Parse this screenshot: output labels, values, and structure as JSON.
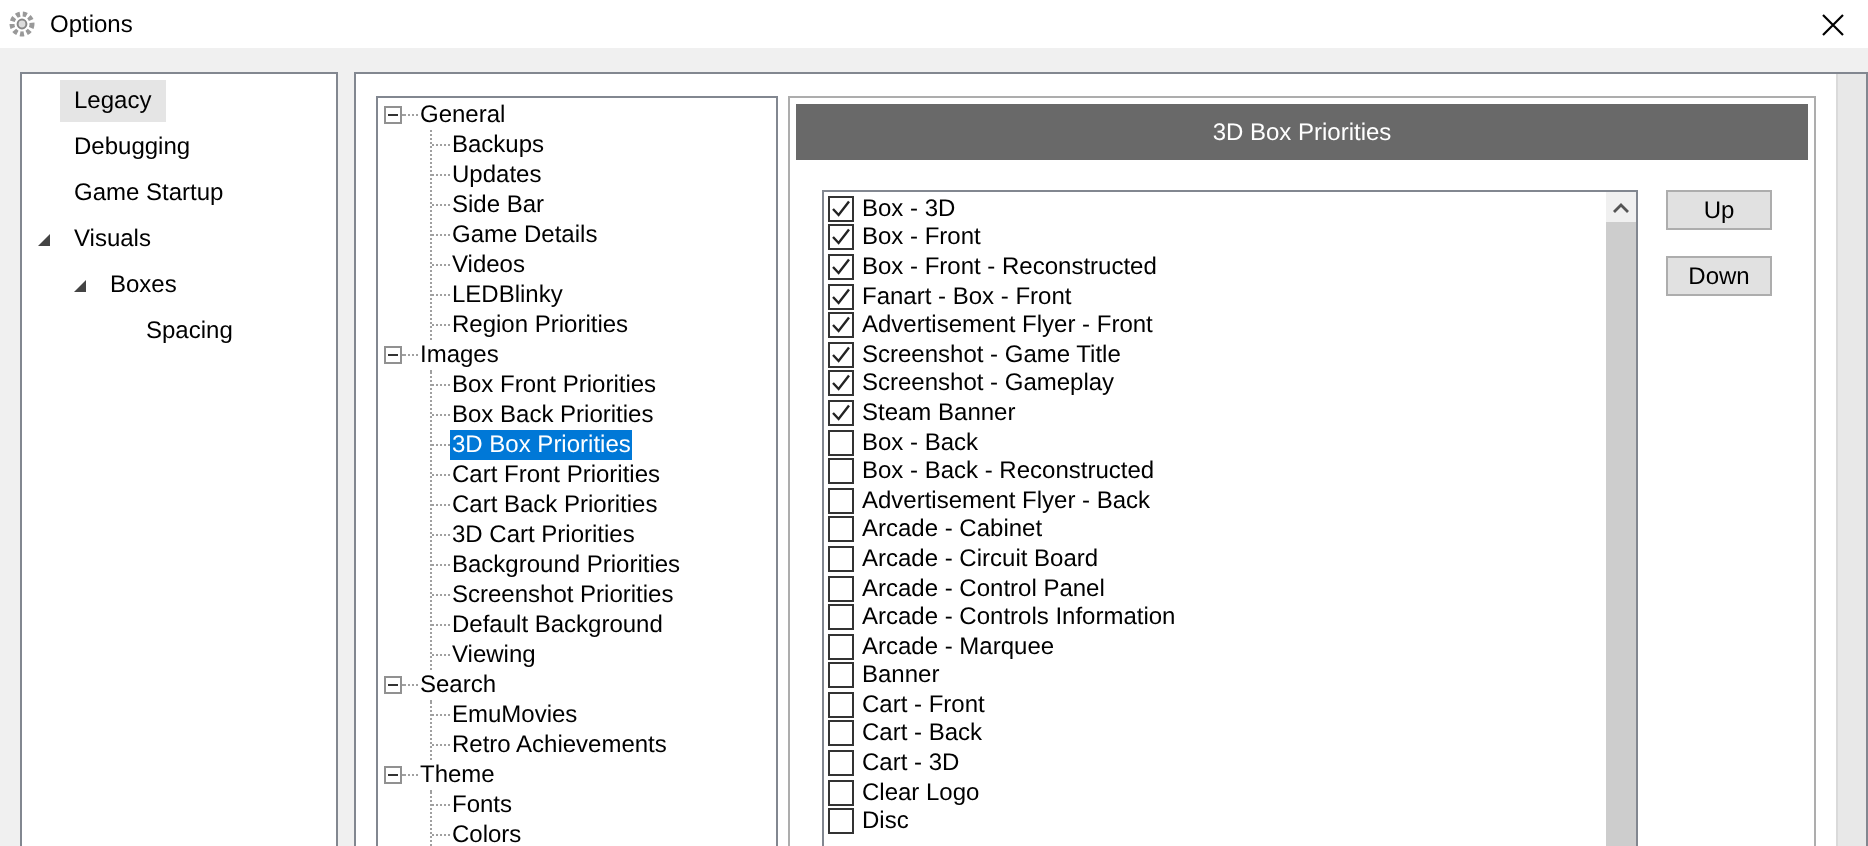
{
  "window": {
    "title": "Options"
  },
  "sidebar": {
    "items": [
      {
        "label": "Legacy",
        "selected": true
      },
      {
        "label": "Debugging",
        "selected": false
      },
      {
        "label": "Game Startup",
        "selected": false
      },
      {
        "label": "Visuals",
        "selected": false,
        "expanded": true,
        "children": [
          {
            "label": "Boxes",
            "selected": false,
            "expanded": true,
            "children": [
              {
                "label": "Spacing",
                "selected": false
              }
            ]
          }
        ]
      }
    ]
  },
  "tree": {
    "items": [
      {
        "label": "General",
        "selected": false,
        "expanded": true,
        "children": [
          {
            "label": "Backups",
            "selected": false
          },
          {
            "label": "Updates",
            "selected": false
          },
          {
            "label": "Side Bar",
            "selected": false
          },
          {
            "label": "Game Details",
            "selected": false
          },
          {
            "label": "Videos",
            "selected": false
          },
          {
            "label": "LEDBlinky",
            "selected": false
          },
          {
            "label": "Region Priorities",
            "selected": false
          }
        ]
      },
      {
        "label": "Images",
        "selected": false,
        "expanded": true,
        "children": [
          {
            "label": "Box Front Priorities",
            "selected": false
          },
          {
            "label": "Box Back Priorities",
            "selected": false
          },
          {
            "label": "3D Box Priorities",
            "selected": true
          },
          {
            "label": "Cart Front Priorities",
            "selected": false
          },
          {
            "label": "Cart Back Priorities",
            "selected": false
          },
          {
            "label": "3D Cart Priorities",
            "selected": false
          },
          {
            "label": "Background Priorities",
            "selected": false
          },
          {
            "label": "Screenshot Priorities",
            "selected": false
          },
          {
            "label": "Default Background",
            "selected": false
          },
          {
            "label": "Viewing",
            "selected": false
          }
        ]
      },
      {
        "label": "Search",
        "selected": false,
        "expanded": true,
        "children": [
          {
            "label": "EmuMovies",
            "selected": false
          },
          {
            "label": "Retro Achievements",
            "selected": false
          }
        ]
      },
      {
        "label": "Theme",
        "selected": false,
        "expanded": true,
        "children": [
          {
            "label": "Fonts",
            "selected": false
          },
          {
            "label": "Colors",
            "selected": false
          }
        ]
      }
    ]
  },
  "panel": {
    "title": "3D Box Priorities",
    "items": [
      {
        "label": "Box - 3D",
        "checked": true
      },
      {
        "label": "Box - Front",
        "checked": true
      },
      {
        "label": "Box - Front - Reconstructed",
        "checked": true
      },
      {
        "label": "Fanart - Box - Front",
        "checked": true
      },
      {
        "label": "Advertisement Flyer - Front",
        "checked": true
      },
      {
        "label": "Screenshot - Game Title",
        "checked": true
      },
      {
        "label": "Screenshot - Gameplay",
        "checked": true
      },
      {
        "label": "Steam Banner",
        "checked": true
      },
      {
        "label": "Box - Back",
        "checked": false
      },
      {
        "label": "Box - Back - Reconstructed",
        "checked": false
      },
      {
        "label": "Advertisement Flyer - Back",
        "checked": false
      },
      {
        "label": "Arcade - Cabinet",
        "checked": false
      },
      {
        "label": "Arcade - Circuit Board",
        "checked": false
      },
      {
        "label": "Arcade - Control Panel",
        "checked": false
      },
      {
        "label": "Arcade - Controls Information",
        "checked": false
      },
      {
        "label": "Arcade - Marquee",
        "checked": false
      },
      {
        "label": "Banner",
        "checked": false
      },
      {
        "label": "Cart - Front",
        "checked": false
      },
      {
        "label": "Cart - Back",
        "checked": false
      },
      {
        "label": "Cart - 3D",
        "checked": false
      },
      {
        "label": "Clear Logo",
        "checked": false
      },
      {
        "label": "Disc",
        "checked": false
      }
    ],
    "buttons": [
      {
        "label": "Up"
      },
      {
        "label": "Down"
      }
    ]
  }
}
